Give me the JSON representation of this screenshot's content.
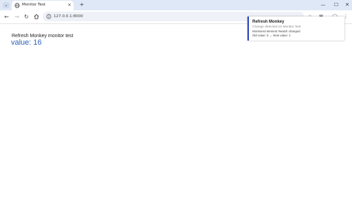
{
  "browser": {
    "tab": {
      "title": "Monitor Test",
      "favicon": "globe-icon"
    },
    "new_tab_glyph": "+",
    "address_bar": {
      "url": "127.0.0.1:8000",
      "icon": "site-info-icon"
    },
    "window_controls": [
      "minimize-icon",
      "maximize-icon",
      "close-icon"
    ],
    "toolbar_icons": [
      "star-icon",
      "extension-icon",
      "profile-icon",
      "menu-icon"
    ]
  },
  "page": {
    "heading": "Refresh Monkey monitor test",
    "value_label": "value: 16"
  },
  "notification": {
    "title": "Refresh Monkey",
    "subtitle": "Change detected on Monitor Test",
    "line1": "Monitored element #watch changed",
    "line2": "Old value: 0 → New value: 1",
    "accent_color": "#2a3fb8"
  },
  "colors": {
    "tabstrip": "#dfe8f6",
    "omnibox": "#eef1f7",
    "value_text": "#2a5fb8"
  }
}
